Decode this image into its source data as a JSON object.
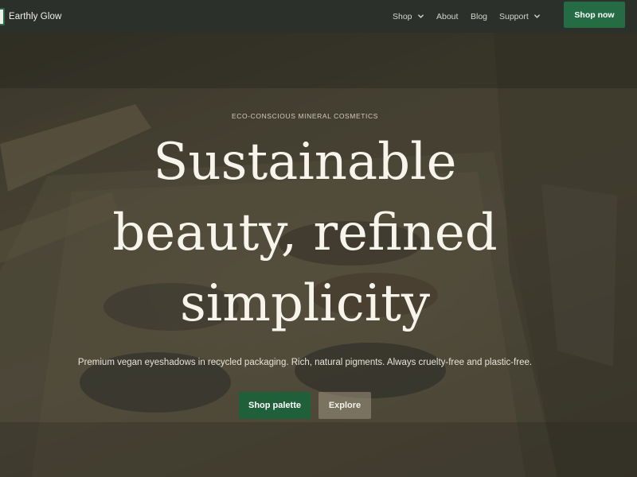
{
  "brand": {
    "name": "Earthly Glow"
  },
  "nav": {
    "items": [
      {
        "label": "Shop",
        "has_dropdown": true
      },
      {
        "label": "About",
        "has_dropdown": false
      },
      {
        "label": "Blog",
        "has_dropdown": false
      },
      {
        "label": "Support",
        "has_dropdown": true
      }
    ],
    "cta_label": "Shop now"
  },
  "hero": {
    "eyebrow": "ECO-CONSCIOUS MINERAL COSMETICS",
    "headline": [
      "Sustainable",
      "beauty, refined",
      "simplicity"
    ],
    "subheading": "Premium vegan eyeshadows in recycled packaging. Rich, natural pigments. Always cruelty-free and plastic-free.",
    "primary_button": "Shop palette",
    "secondary_button": "Explore"
  },
  "colors": {
    "header_bg": "#2b302b",
    "accent_green": "#256b43",
    "headline_text": "#f7f4ec"
  }
}
